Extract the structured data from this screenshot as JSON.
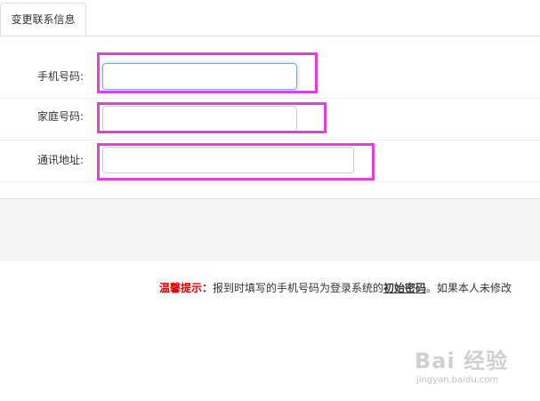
{
  "tabs": [
    {
      "label": "变更联系信息",
      "active": true
    }
  ],
  "form": {
    "mobile": {
      "label": "手机号码:",
      "value": "",
      "placeholder": ""
    },
    "home_phone": {
      "label": "家庭号码:",
      "value": "",
      "placeholder": ""
    },
    "address": {
      "label": "通讯地址:",
      "value": "",
      "placeholder": ""
    }
  },
  "tip": {
    "label": "温馨提示：",
    "text_before": "报到时填写的手机号码为登录系统的",
    "emphasis": "初始密码",
    "text_after": "。如果本人未修改"
  },
  "watermark": {
    "text": "Bai 经验",
    "url": "jingyan.baidu.com"
  },
  "colors": {
    "highlight": "#e040e0",
    "tip_label": "#e00000",
    "focus_border": "#66afe9"
  }
}
